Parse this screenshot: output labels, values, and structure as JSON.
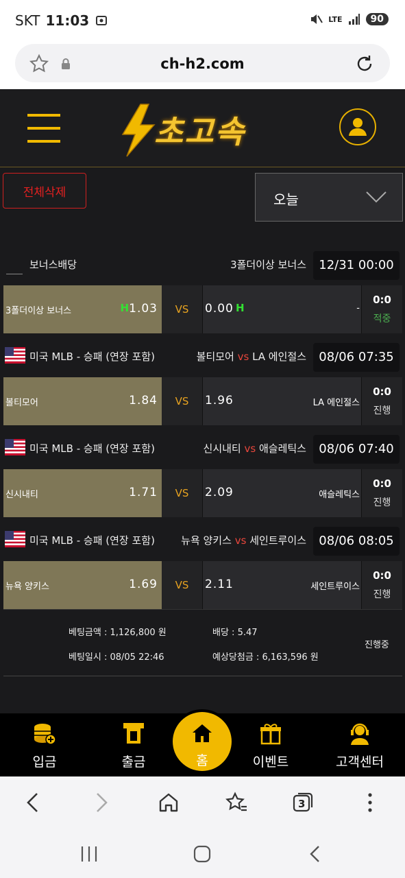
{
  "status_bar": {
    "carrier": "SKT",
    "time": "11:03",
    "network": "LTE",
    "battery": "90"
  },
  "browser": {
    "url": "ch-h2.com",
    "tab_count": "3"
  },
  "header": {
    "logo_text": "초고속"
  },
  "controls": {
    "delete_all_label": "전체삭제",
    "date_filter_value": "오늘"
  },
  "bets": [
    {
      "league": "보너스배당",
      "has_flag": false,
      "matchup_home": "3폴더이상 보너스",
      "matchup_away": "",
      "datetime": "12/31 00:00",
      "home_name": "3폴더이상 보너스",
      "home_mark": "H",
      "home_odd": "1.03",
      "vs": "VS",
      "away_odd": "0.00",
      "away_mark": "H",
      "away_name": "-",
      "score": "0:0",
      "status": "적중",
      "status_color": "#4caf50"
    },
    {
      "league": "미국 MLB - 승패 (연장 포함)",
      "has_flag": true,
      "matchup_home": "볼티모어",
      "matchup_vs": "vs",
      "matchup_away": "LA 에인절스",
      "datetime": "08/06 07:35",
      "home_name": "볼티모어",
      "home_mark": "",
      "home_odd": "1.84",
      "vs": "VS",
      "away_odd": "1.96",
      "away_mark": "",
      "away_name": "LA 에인절스",
      "score": "0:0",
      "status": "진행",
      "status_color": "#dddddd"
    },
    {
      "league": "미국 MLB - 승패 (연장 포함)",
      "has_flag": true,
      "matchup_home": "신시내티",
      "matchup_vs": "vs",
      "matchup_away": "애슬레틱스",
      "datetime": "08/06 07:40",
      "home_name": "신시내티",
      "home_mark": "",
      "home_odd": "1.71",
      "vs": "VS",
      "away_odd": "2.09",
      "away_mark": "",
      "away_name": "애슬레틱스",
      "score": "0:0",
      "status": "진행",
      "status_color": "#dddddd"
    },
    {
      "league": "미국 MLB - 승패 (연장 포함)",
      "has_flag": true,
      "matchup_home": "뉴욕 양키스",
      "matchup_vs": "vs",
      "matchup_away": "세인트루이스",
      "datetime": "08/06 08:05",
      "home_name": "뉴욕 양키스",
      "home_mark": "",
      "home_odd": "1.69",
      "vs": "VS",
      "away_odd": "2.11",
      "away_mark": "",
      "away_name": "세인트루이스",
      "score": "0:0",
      "status": "진행",
      "status_color": "#dddddd"
    }
  ],
  "summary": {
    "bet_amount": "베팅금액 : 1,126,800 원",
    "odds": "배당 : 5.47",
    "bet_time": "베팅일시 : 08/05 22:46",
    "expected_payout": "예상당첨금 : 6,163,596 원",
    "status": "진행중"
  },
  "bottom_nav": [
    {
      "label": "입금",
      "icon": "coins-icon"
    },
    {
      "label": "출금",
      "icon": "withdraw-icon"
    },
    {
      "label": "홈",
      "icon": "home-icon"
    },
    {
      "label": "이벤트",
      "icon": "gift-icon"
    },
    {
      "label": "고객센터",
      "icon": "headset-icon"
    }
  ],
  "colors": {
    "accent": "#f1b900",
    "home_cell": "#7f7757",
    "vs_text": "#e8a320",
    "delete_red": "#e52020",
    "win_green": "#4caf50"
  }
}
